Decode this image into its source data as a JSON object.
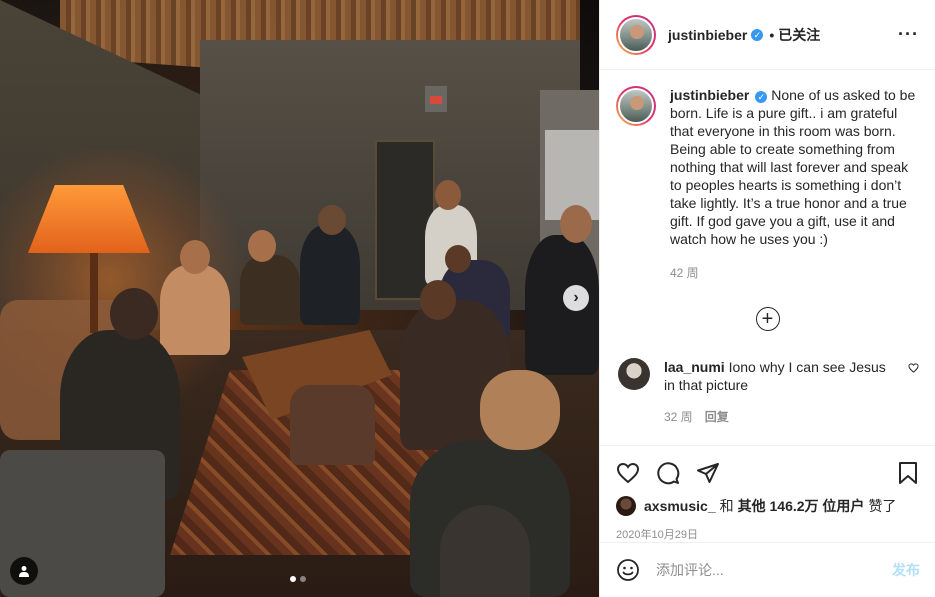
{
  "post": {
    "photo_alt": "Group of people sitting in a dimly lit studio room",
    "carousel": {
      "total": 2,
      "current": 1
    },
    "icons": {
      "next": "chevron-right-icon",
      "tag": "user-tag-icon"
    }
  },
  "header": {
    "username": "justinbieber",
    "verified_icon": "verified-badge-icon",
    "separator": "•",
    "follow_status": "已关注",
    "more_icon": "more-options-icon"
  },
  "caption": {
    "username": "justinbieber",
    "text": "None of us asked to be born. Life is a pure gift.. i am grateful that everyone in this room was born. Being able to create something from nothing that will last forever and speak to peoples hearts is something i don’t take lightly. It’s a true honor and a true gift. If god gave you a gift, use it and watch how he uses you :)",
    "time": "42 周"
  },
  "load_more_icon": "plus-circle-icon",
  "comments": [
    {
      "username": "laa_numi",
      "text": "Iono why I can see Jesus in that picture",
      "time": "32 周",
      "reply_label": "回复"
    }
  ],
  "actions": {
    "icons": [
      "heart-icon",
      "comment-icon",
      "share-icon",
      "bookmark-icon"
    ]
  },
  "likes": {
    "user": "axsmusic_",
    "connector": "和",
    "others": "其他 146.2万 位用户",
    "suffix": "赞了"
  },
  "date": "2020年10月29日",
  "add_comment": {
    "placeholder": "添加评论...",
    "post_label": "发布",
    "emoji_icon": "emoji-icon"
  },
  "colors": {
    "text": "#262626",
    "secondary": "#8e8e8e",
    "verified": "#3897f0",
    "post_disabled": "#b2dffc",
    "border": "#efefef"
  }
}
